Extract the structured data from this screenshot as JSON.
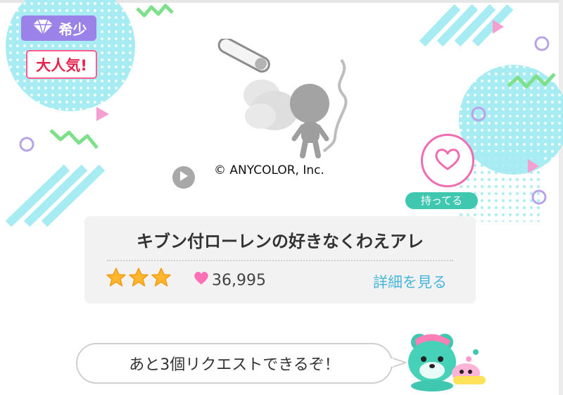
{
  "badges": {
    "rare_label": "希少",
    "rare_icon": "diamond-icon",
    "popular_label": "大人気!"
  },
  "artwork": {
    "copyright": "© ANYCOLOR, Inc."
  },
  "controls": {
    "play_icon": "play-icon",
    "favorite_icon": "heart-icon",
    "owned_label": "持ってる"
  },
  "song": {
    "title": "キブン付ローレンの好きなくわえアレ",
    "stars": 3,
    "likes": "36,995",
    "detail_label": "詳細を見る"
  },
  "footer": {
    "request_message": "あと3個リクエストできるぞ！"
  },
  "colors": {
    "accent_cyan": "#a7ecf2",
    "accent_pink": "#f06cb0",
    "owned_green": "#3fc7b0",
    "rare_purple": "#9b82e8",
    "popular_red": "#e8234e",
    "link_blue": "#49b6dc",
    "star_gold": "#ffb52e"
  }
}
